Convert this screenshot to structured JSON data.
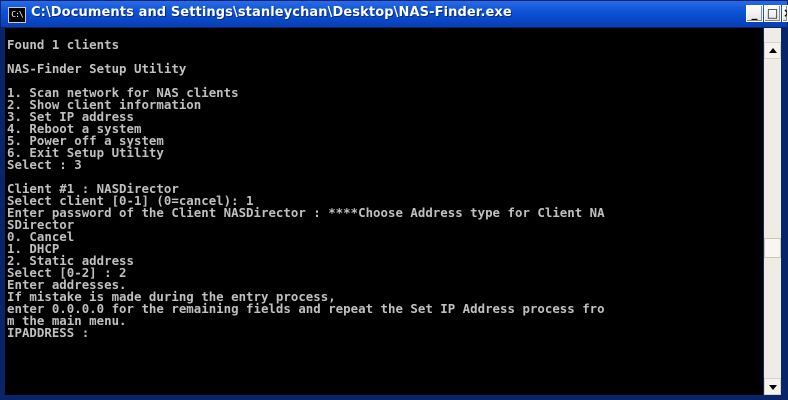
{
  "window": {
    "title": "C:\\Documents and Settings\\stanleychan\\Desktop\\NAS-Finder.exe",
    "icon_text": "C:\\",
    "icon": "console-icon",
    "minimize_label": "_",
    "maximize_label": "□",
    "close_label": "×"
  },
  "console": {
    "lines": [
      "Found 1 clients",
      "",
      "NAS-Finder Setup Utility",
      "",
      "1. Scan network for NAS clients",
      "2. Show client information",
      "3. Set IP address",
      "4. Reboot a system",
      "5. Power off a system",
      "6. Exit Setup Utility",
      "Select : 3",
      "",
      "Client #1 : NASDirector",
      "Select client [0-1] (0=cancel): 1",
      "Enter password of the Client NASDirector : ****Choose Address type for Client NA",
      "SDirector",
      "0. Cancel",
      "1. DHCP",
      "2. Static address",
      "Select [0-2] : 2",
      "Enter addresses.",
      "If mistake is made during the entry process,",
      "enter 0.0.0.0 for the remaining fields and repeat the Set IP Address process fro",
      "m the main menu.",
      "IPADDRESS :"
    ]
  },
  "colors": {
    "console_bg": "#000000",
    "console_fg": "#c0c0c0",
    "titlebar": "#0b54d6"
  }
}
